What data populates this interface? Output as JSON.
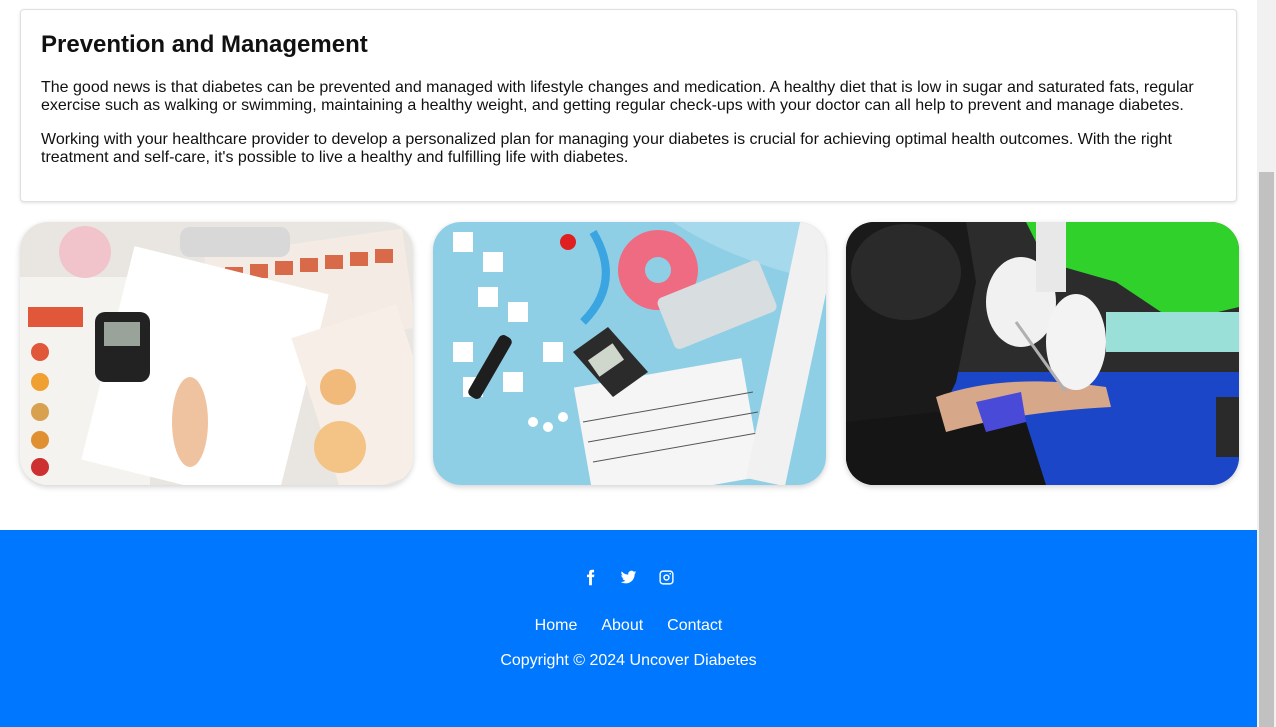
{
  "section": {
    "title": "Prevention and Management",
    "paragraph1": "The good news is that diabetes can be prevented and managed with lifestyle changes and medication. A healthy diet that is low in sugar and saturated fats, regular exercise such as walking or swimming, maintaining a healthy weight, and getting regular check-ups with your doctor can all help to prevent and manage diabetes.",
    "paragraph2": "Working with your healthcare provider to develop a personalized plan for managing your diabetes is crucial for achieving optimal health outcomes. With the right treatment and self-care, it's possible to live a healthy and fulfilling life with diabetes."
  },
  "footer": {
    "social": [
      "facebook-icon",
      "twitter-icon",
      "instagram-icon"
    ],
    "links": [
      "Home",
      "About",
      "Contact"
    ],
    "copyright": "Copyright © 2024 Uncover Diabetes"
  },
  "colors": {
    "footer_bg": "#0077ff"
  }
}
